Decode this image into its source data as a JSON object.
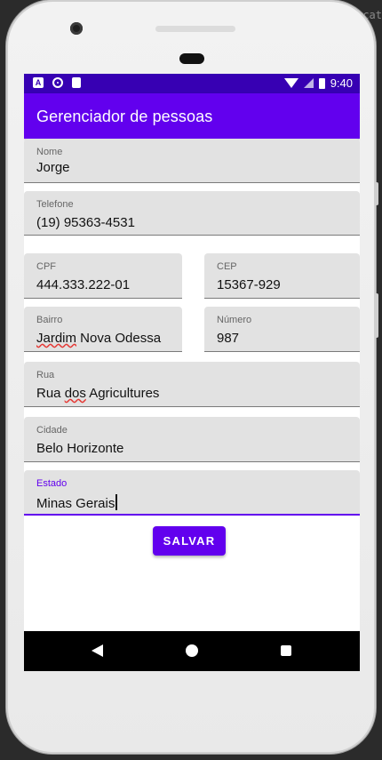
{
  "ide": {
    "corner_text": "cat"
  },
  "status_bar": {
    "time": "9:40",
    "left_icons": [
      "a-notification-icon",
      "circle-notification-icon",
      "sd-card-icon"
    ],
    "right_icons": [
      "wifi-icon",
      "signal-icon",
      "battery-icon"
    ]
  },
  "app_bar": {
    "title": "Gerenciador de pessoas",
    "color": "#6200ee",
    "status_color": "#3700b3"
  },
  "form": {
    "nome": {
      "label": "Nome",
      "value": "Jorge"
    },
    "telefone": {
      "label": "Telefone",
      "value": "(19) 95363-4531"
    },
    "cpf": {
      "label": "CPF",
      "value": "444.333.222-01"
    },
    "cep": {
      "label": "CEP",
      "value": "15367-929"
    },
    "bairro": {
      "label": "Bairro",
      "value_part1": "Jardim",
      "value_part2": " Nova Odessa"
    },
    "numero": {
      "label": "Número",
      "value": "987"
    },
    "rua": {
      "label": "Rua",
      "value_part1": "Rua ",
      "value_part2": "dos",
      "value_part3": " Agricultures"
    },
    "cidade": {
      "label": "Cidade",
      "value": "Belo Horizonte"
    },
    "estado": {
      "label": "Estado",
      "value": "Minas Gerais"
    }
  },
  "save_button": {
    "label": "SALVAR"
  },
  "nav_bar": {
    "icons": [
      "back-icon",
      "home-icon",
      "recents-icon"
    ]
  }
}
